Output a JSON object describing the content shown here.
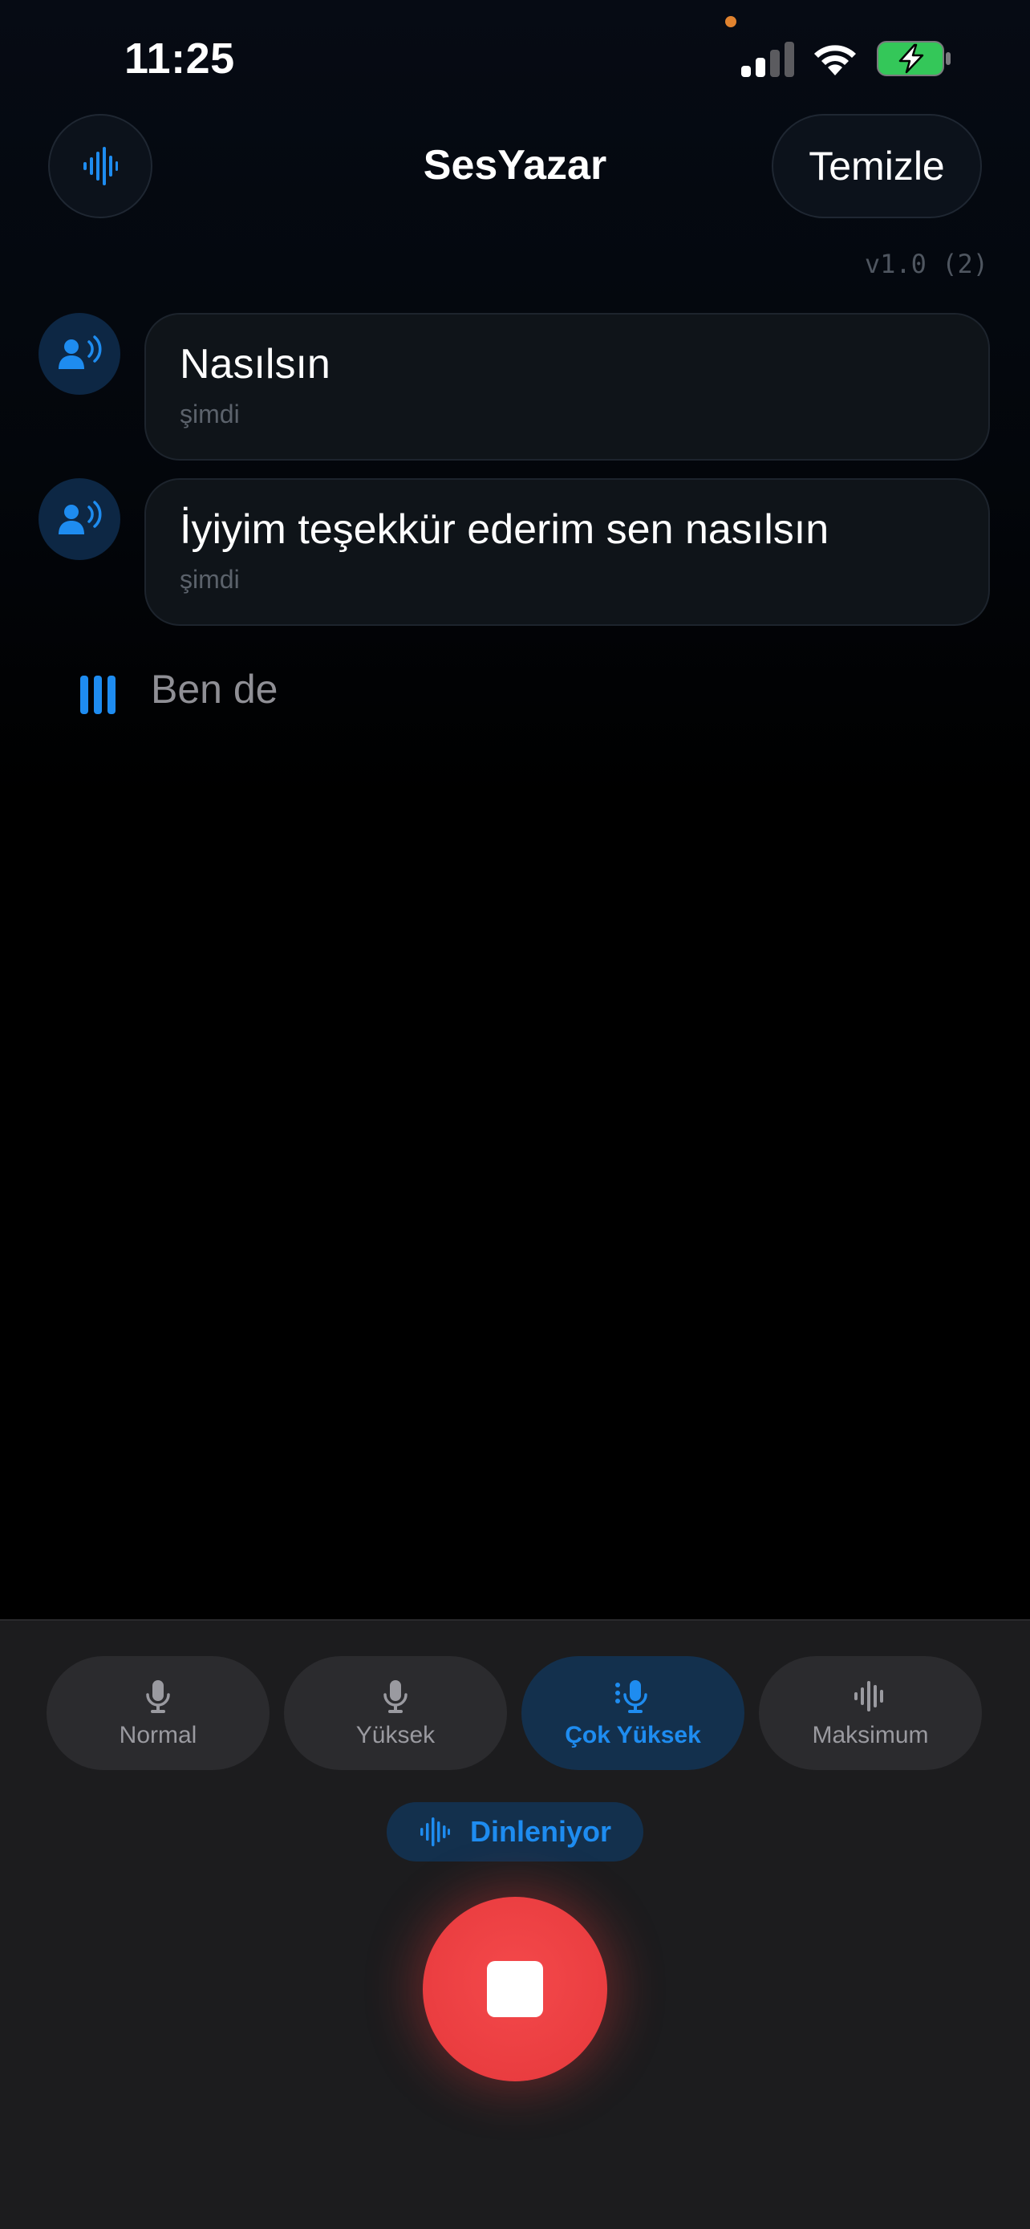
{
  "status_bar": {
    "time": "11:25",
    "signal_bars_active": 2,
    "battery_state": "charging",
    "battery_color": "#34c759"
  },
  "header": {
    "title": "SesYazar",
    "logo_icon": "waveform-icon",
    "clear_label": "Temizle",
    "version": "v1.0 (2)"
  },
  "messages": [
    {
      "text": "Nasılsın",
      "time": "şimdi",
      "avatar_icon": "speaking-person-icon"
    },
    {
      "text": "İyiyim teşekkür ederim sen nasılsın",
      "time": "şimdi",
      "avatar_icon": "speaking-person-icon"
    }
  ],
  "live_transcript": {
    "text": "Ben de",
    "icon": "audio-level-icon"
  },
  "sensitivity_modes": [
    {
      "label": "Normal",
      "icon": "microphone-icon",
      "active": false
    },
    {
      "label": "Yüksek",
      "icon": "microphone-icon",
      "active": false
    },
    {
      "label": "Çok Yüksek",
      "icon": "microphone-boost-icon",
      "active": true
    },
    {
      "label": "Maksimum",
      "icon": "waveform-icon",
      "active": false
    }
  ],
  "listening_status": {
    "label": "Dinleniyor",
    "icon": "waveform-icon"
  },
  "record_button": {
    "state": "recording",
    "icon": "stop-icon"
  },
  "colors": {
    "accent": "#1e8cf0",
    "record": "#ea3d40",
    "panel": "#1c1c1e"
  }
}
